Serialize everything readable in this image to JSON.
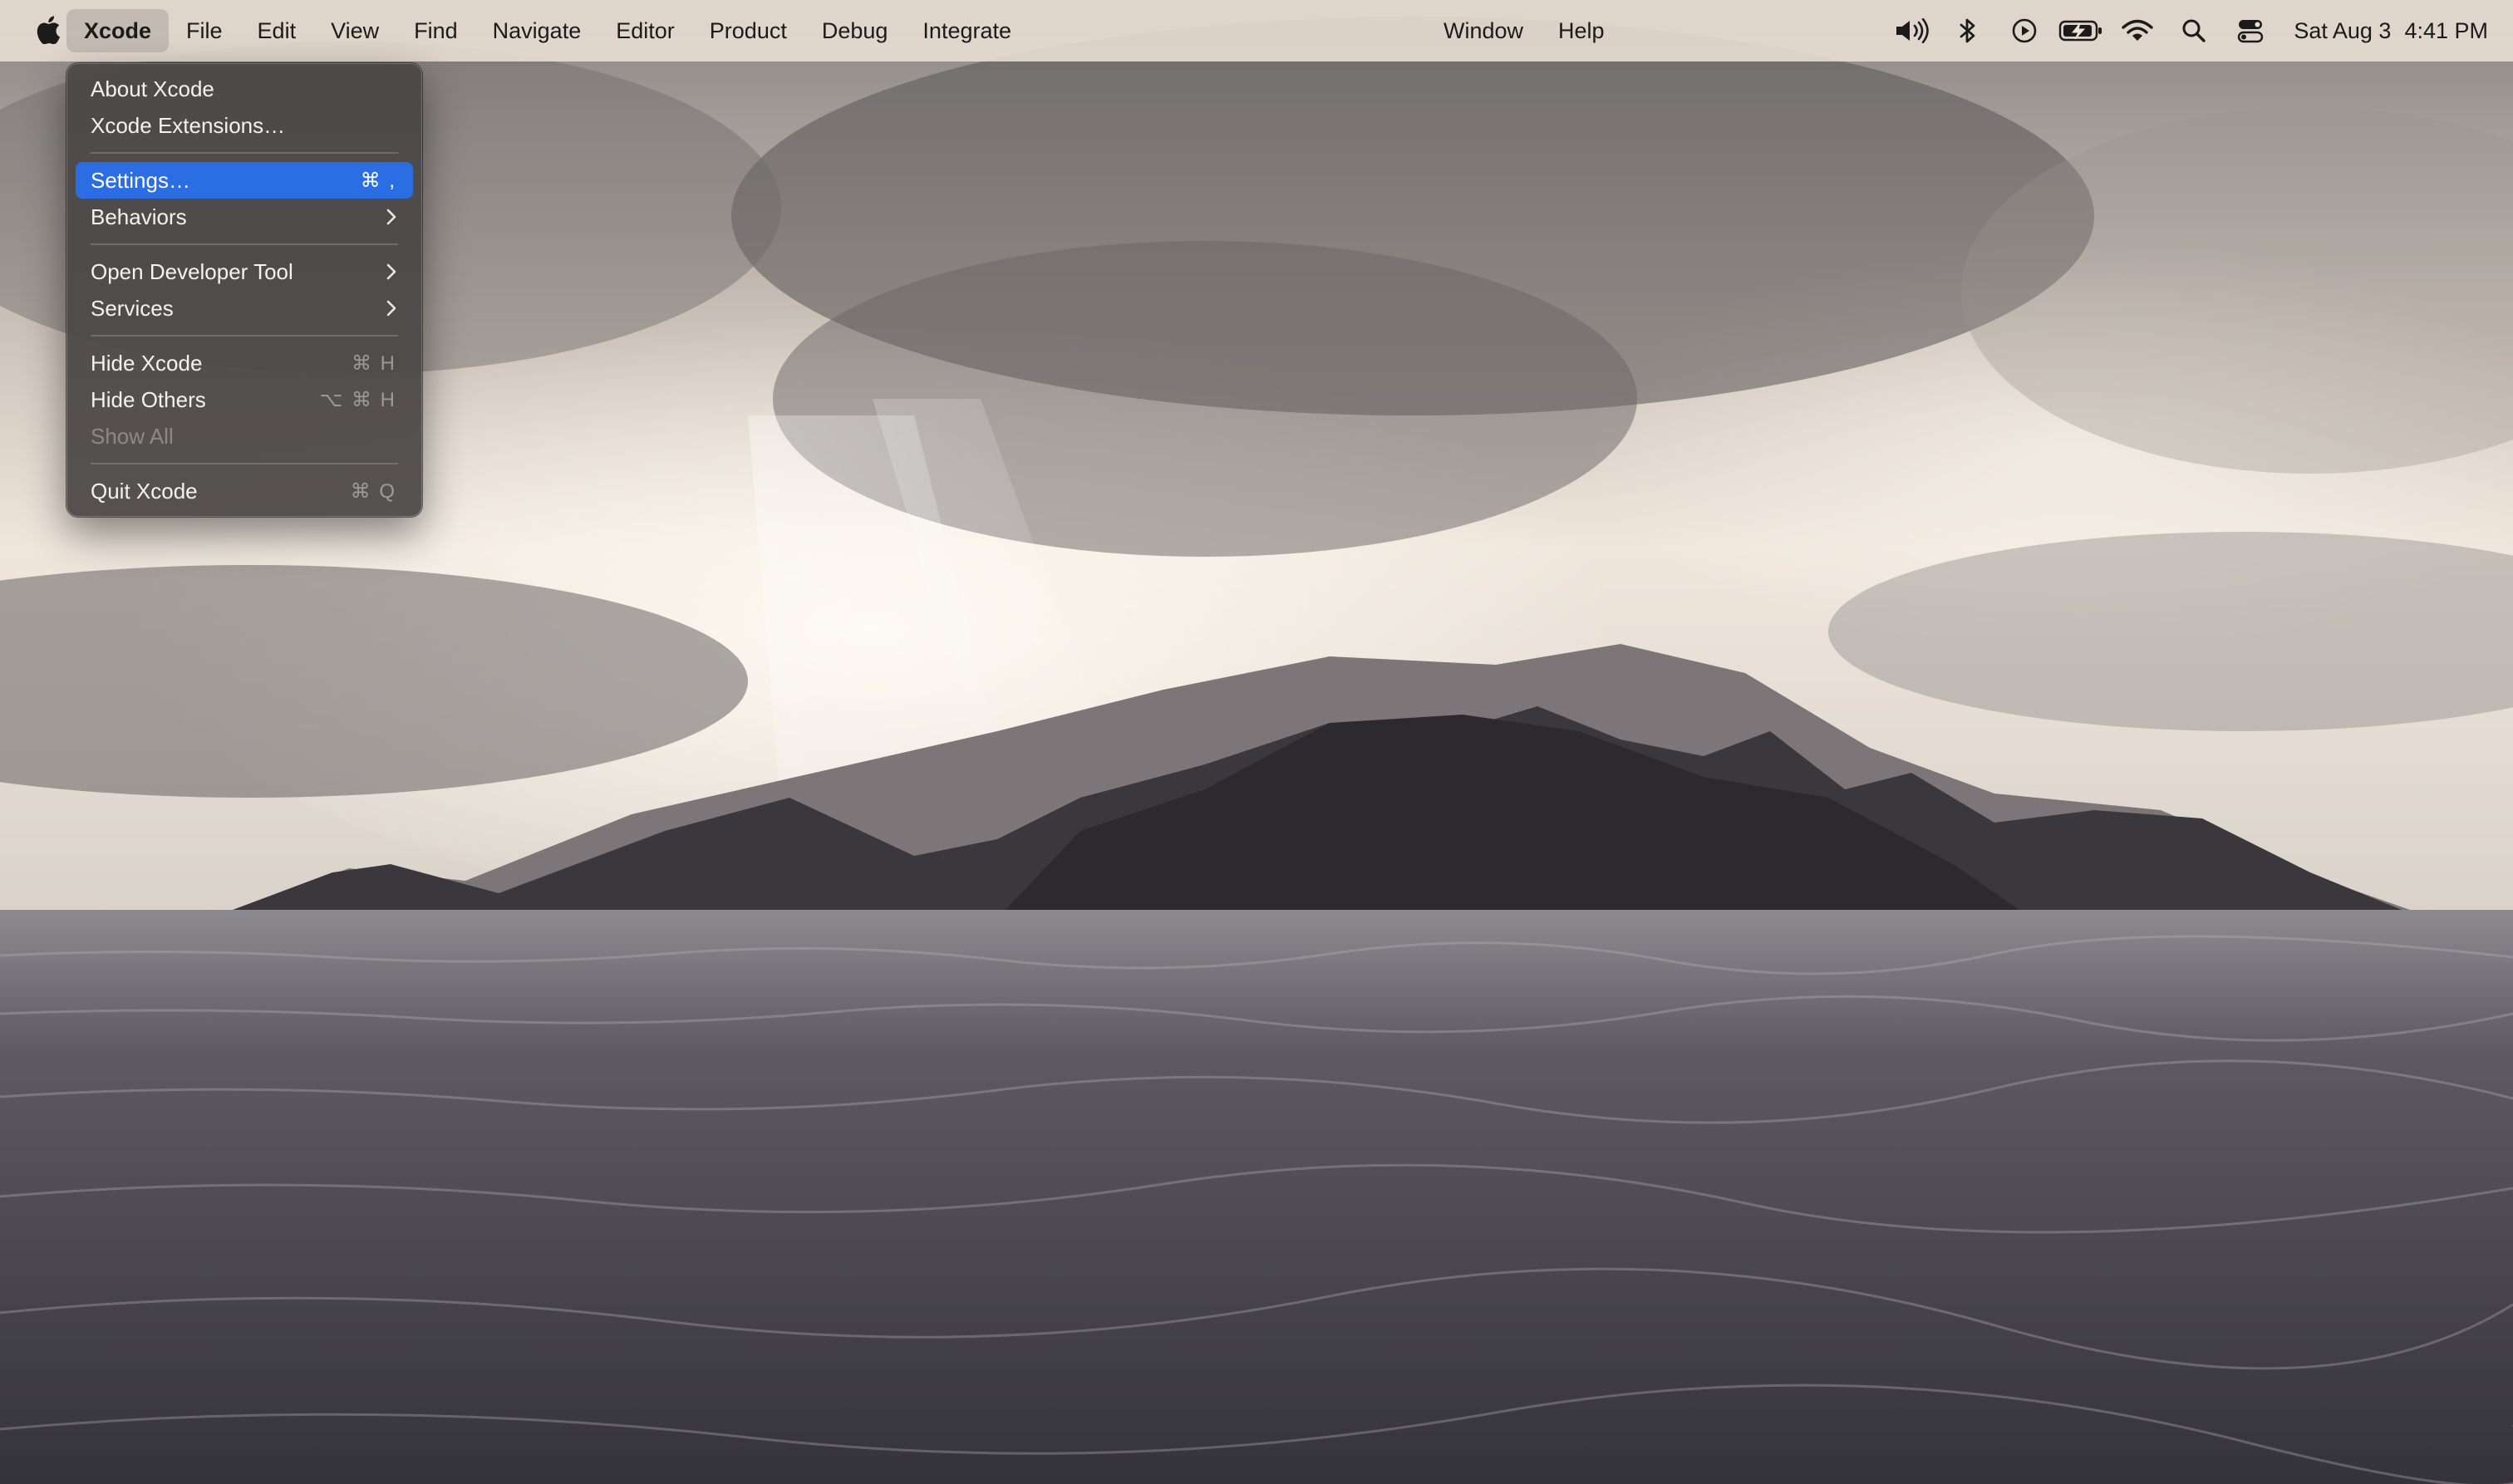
{
  "menubar": {
    "app_name": "Xcode",
    "items": [
      "File",
      "Edit",
      "View",
      "Find",
      "Navigate",
      "Editor",
      "Product",
      "Debug",
      "Integrate"
    ],
    "right_items": [
      "Window",
      "Help"
    ],
    "status_icons": [
      "volume-icon",
      "bluetooth-icon",
      "now-playing-icon",
      "battery-charging-icon",
      "wifi-icon",
      "spotlight-search-icon",
      "control-center-icon"
    ],
    "date": "Sat Aug 3",
    "time": "4:41 PM"
  },
  "app_menu": {
    "about": "About Xcode",
    "extensions": "Xcode Extensions…",
    "settings": "Settings…",
    "settings_shortcut": "⌘ ,",
    "behaviors": "Behaviors",
    "open_dev_tool": "Open Developer Tool",
    "services": "Services",
    "hide": "Hide Xcode",
    "hide_shortcut": "⌘ H",
    "hide_others": "Hide Others",
    "hide_others_shortcut": "⌥ ⌘ H",
    "show_all": "Show All",
    "quit": "Quit Xcode",
    "quit_shortcut": "⌘ Q",
    "highlight_color": "#2b6de3"
  }
}
